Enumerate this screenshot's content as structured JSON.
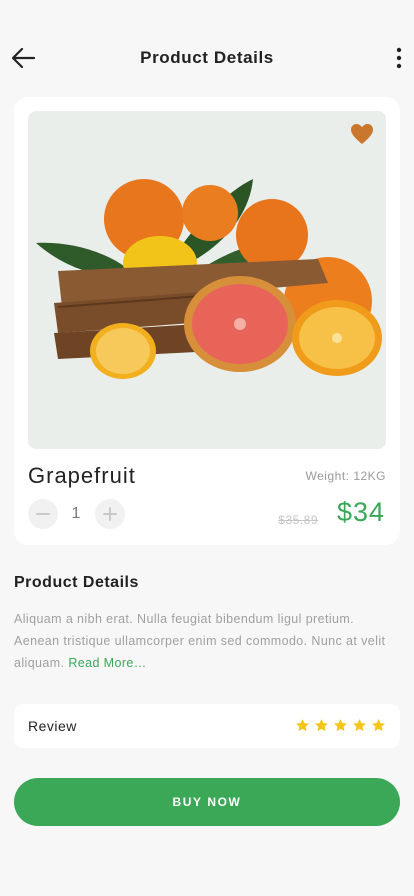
{
  "header": {
    "title": "Product Details",
    "back_icon": "arrow-left-icon",
    "more_icon": "more-vertical-icon"
  },
  "product": {
    "name": "Grapefruit",
    "weight": "Weight: 12KG",
    "quantity": "1",
    "old_price": "$35.89",
    "price": "$34",
    "favorite_icon": "heart-icon",
    "favorite_color": "#c8772d",
    "image_icon": "citrus-fruit-crate-image"
  },
  "details": {
    "title": "Product Details",
    "text": "Aliquam a nibh erat. Nulla feugiat bibendum ligul pretium. Aenean tristique ullamcorper enim sed commodo. Nunc at velit aliquam. ",
    "read_more": "Read More…"
  },
  "review": {
    "label": "Review",
    "rating": 5,
    "max_rating": 5,
    "star_color": "#f5c518"
  },
  "buy": {
    "label": "BUY NOW"
  },
  "colors": {
    "accent": "#3aa856",
    "background": "#f7f7f8"
  }
}
